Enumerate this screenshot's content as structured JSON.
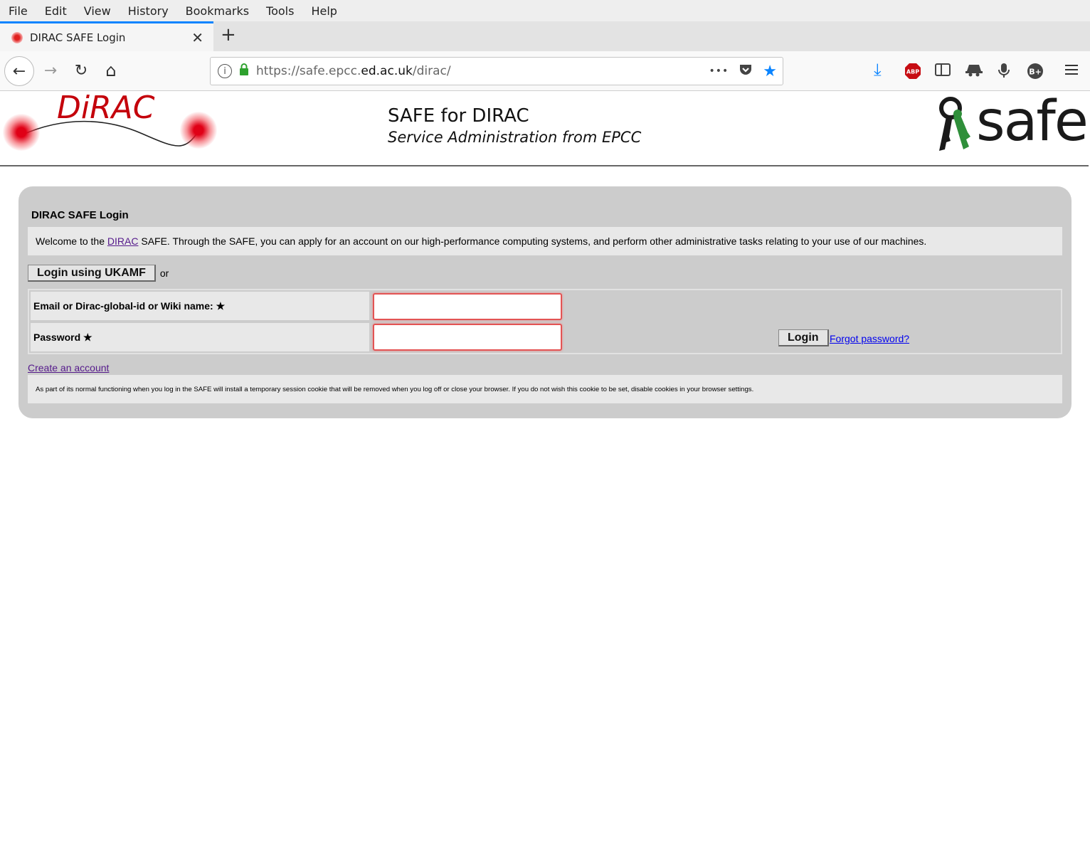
{
  "menu": [
    "File",
    "Edit",
    "View",
    "History",
    "Bookmarks",
    "Tools",
    "Help"
  ],
  "tab": {
    "title": "DIRAC SAFE Login",
    "close": "✕",
    "new_tab": "+"
  },
  "nav": {
    "back": "←",
    "forward": "→",
    "reload": "↻",
    "home": "⌂"
  },
  "url": {
    "prefix": "https://safe.epcc.",
    "domain": "ed.ac.uk",
    "path": "/dirac/",
    "more": "•••"
  },
  "header": {
    "logo_text": "DiRAC",
    "title": "SAFE for DIRAC",
    "subtitle": "Service Administration from EPCC",
    "safe_logo_text": "safe"
  },
  "panel": {
    "title": "DIRAC SAFE Login",
    "welcome_before": "Welcome to the ",
    "welcome_link": "DIRAC",
    "welcome_after": " SAFE. Through the SAFE, you can apply for an account on our high-performance computing systems, and perform other administrative tasks relating to your use of our machines.",
    "ukamf_button": "Login using UKAMF",
    "or_text": "or",
    "email_label": "Email or Dirac-global-id or Wiki name: ★",
    "password_label": "Password ★",
    "email_value": "",
    "password_value": "",
    "login_button": "Login",
    "forgot_link": "Forgot password?",
    "create_link": "Create an account",
    "cookie_notice": "As part of its normal functioning when you log in the SAFE will install a temporary session cookie that will be removed when you log off or close your browser. If you do not wish this cookie to be set, disable cookies in your browser settings."
  },
  "colors": {
    "accent": "#0a84ff",
    "dirac_red": "#c4000b",
    "field_border": "#e35454",
    "panel_bg": "#cccccc"
  }
}
